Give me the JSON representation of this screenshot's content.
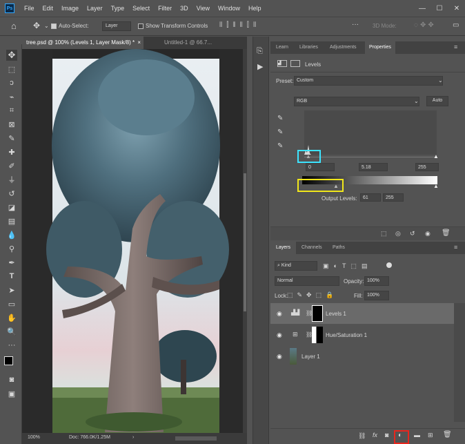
{
  "app": {
    "logo": "Ps"
  },
  "menu": [
    "File",
    "Edit",
    "Image",
    "Layer",
    "Type",
    "Select",
    "Filter",
    "3D",
    "View",
    "Window",
    "Help"
  ],
  "options": {
    "auto_select_label": "Auto-Select:",
    "auto_select_value": "Layer",
    "transform_label": "Show Transform Controls",
    "mode_3d": "3D Mode:",
    "more": "···"
  },
  "doc_tabs": [
    {
      "label": "tree.psd @ 100% (Levels 1, Layer Mask/8) *"
    },
    {
      "label": "Untitled-1 @ 66.7..."
    }
  ],
  "status": {
    "zoom": "100%",
    "doc": "Doc: 766.0K/1.25M"
  },
  "properties": {
    "tabs": [
      "Learn",
      "Libraries",
      "Adjustments",
      "Properties"
    ],
    "adjustment": "Levels",
    "preset_label": "Preset:",
    "preset_value": "Custom",
    "channel": "RGB",
    "auto": "Auto",
    "input_black": "0",
    "input_gamma": "5.18",
    "input_white": "255",
    "output_label": "Output Levels:",
    "output_black": "61",
    "output_white": "255"
  },
  "layers": {
    "tabs": [
      "Layers",
      "Channels",
      "Paths"
    ],
    "kind": "Kind",
    "blend": "Normal",
    "opacity_label": "Opacity:",
    "opacity_value": "100%",
    "lock_label": "Lock:",
    "fill_label": "Fill:",
    "fill_value": "100%",
    "items": [
      {
        "name": "Levels 1"
      },
      {
        "name": "Hue/Saturation 1"
      },
      {
        "name": "Layer 1"
      }
    ]
  },
  "colors": {
    "highlight_cyan": "#3ce4ff",
    "highlight_yellow": "#f1e71a",
    "highlight_red": "#e8261d",
    "selected_row": "#6a6a6a"
  }
}
